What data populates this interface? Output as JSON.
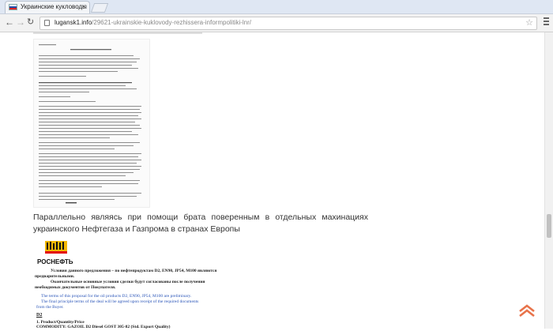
{
  "browser": {
    "tab_title": "Украинские кукловоды",
    "tab_close": "×",
    "url_host": "lugansk1.info",
    "url_path": "/29621-ukrainskie-kuklovody-rezhissera-informpolitiki-lnr/",
    "icons": {
      "back": "arrow-left-icon",
      "forward": "arrow-right-icon",
      "reload": "reload-icon",
      "star": "star-icon",
      "menu": "hamburger-menu-icon"
    }
  },
  "article": {
    "caption": "Параллельно являясь при помощи брата поверенным в отдельных махинациях украинского Нефтегаза и Газпрома в странах Европы",
    "doc2": {
      "logo_text": "РОСНЕФТЬ",
      "ru_line1": "Условия данного предложения – по нефтепродуктам D2, EN90, JP54, M100 являются",
      "ru_line2": "предварительными.",
      "ru_line3": "Окончательные основные условия сделки будут согласованы после получения",
      "ru_line4": "необходимых документов от Покупателя.",
      "en_line1": "The terms of this proposal for the oil products D2, EN90, JP54, M100 are preliminary.",
      "en_line2": "The final principle terms of the deal will be agreed upon receipt of the required documents",
      "en_line3": "from the Buyer.",
      "section": "D2",
      "spec1": "1. Product/Quantity/Price",
      "spec2": "COMMODITY:      GAZOIL D2 Diesel GOST 305-82 (Std. Export Quality)"
    }
  },
  "colors": {
    "accent_logo": "#f2b705",
    "logo_red": "#e30613",
    "en_text": "#2a55b8",
    "scroll_top_arrow": "#e8734a"
  }
}
